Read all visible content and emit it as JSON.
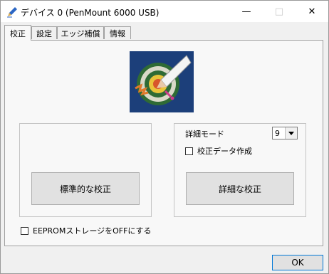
{
  "window": {
    "title": "デバイス 0 (PenMount 6000 USB)",
    "controls": {
      "minimize": "—",
      "maximize": "□",
      "close": "✕"
    }
  },
  "tabs": [
    {
      "label": "校正",
      "active": true
    },
    {
      "label": "設定",
      "active": false
    },
    {
      "label": "エッジ補償",
      "active": false
    },
    {
      "label": "情報",
      "active": false
    }
  ],
  "calibration": {
    "standard_button": "標準的な校正",
    "detail_mode_label": "詳細モード",
    "detail_mode_value": "9",
    "create_data_checkbox": {
      "label": "校正データ作成",
      "checked": false
    },
    "advanced_button": "詳細な校正",
    "eeprom_checkbox": {
      "label": "EEPROMストレージをOFFにする",
      "checked": false
    }
  },
  "footer": {
    "ok_button": "OK"
  },
  "icons": {
    "app": "pen-icon",
    "logo": "target-arrow-logo"
  },
  "colors": {
    "logo_bg": "#1c3f7a",
    "accent_blue": "#0078d7"
  }
}
